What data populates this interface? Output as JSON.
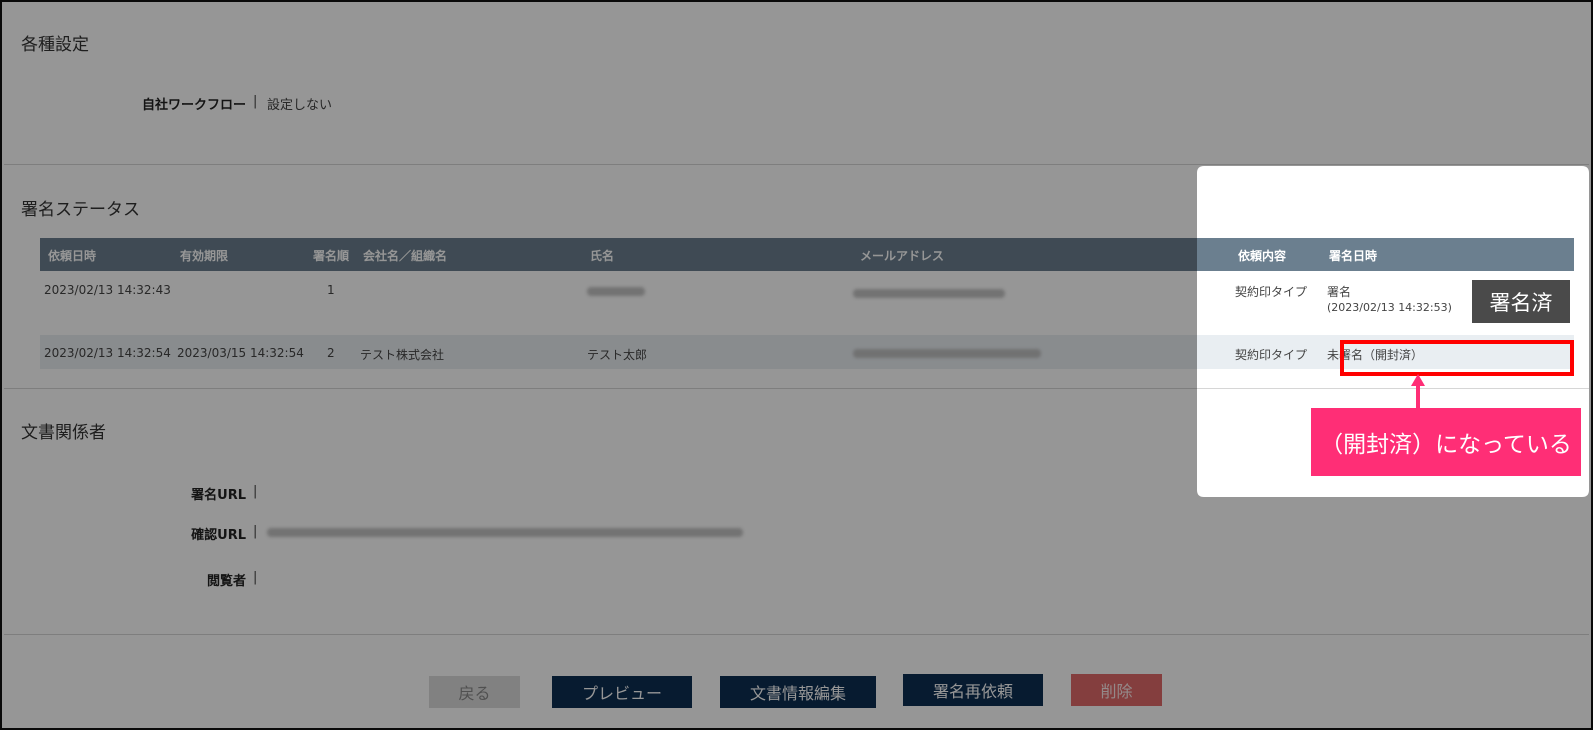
{
  "settings": {
    "title": "各種設定",
    "workflow_label": "自社ワークフロー",
    "separator": "|",
    "workflow_value": "設定しない"
  },
  "signature_status": {
    "title": "署名ステータス",
    "headers": [
      "依頼日時",
      "有効期限",
      "署名順",
      "会社名／組織名",
      "氏名",
      "メールアドレス",
      "依頼内容",
      "署名日時"
    ],
    "rows": [
      {
        "requested_at": "2023/02/13 14:32:43",
        "expires_at": "",
        "order": "1",
        "company": "",
        "name_redacted": true,
        "email_redacted": true,
        "request_type": "契約印タイプ",
        "sign_status": "署名",
        "sign_date": "(2023/02/13 14:32:53)"
      },
      {
        "requested_at": "2023/02/13 14:32:54",
        "expires_at": "2023/03/15 14:32:54",
        "order": "2",
        "company": "テスト株式会社",
        "name": "テスト太郎",
        "email_redacted": true,
        "request_type": "契約印タイプ",
        "sign_status": "未署名（開封済）"
      }
    ]
  },
  "related": {
    "title": "文書関係者",
    "sign_url_label": "署名URL",
    "confirm_url_label": "確認URL",
    "viewer_label": "閲覧者",
    "separator": "|"
  },
  "buttons": {
    "back": "戻る",
    "preview": "プレビュー",
    "edit_info": "文書情報編集",
    "resend": "署名再依頼",
    "delete": "削除"
  },
  "annotations": {
    "signed_badge": "署名済",
    "callout": "（開封済）になっている"
  },
  "colors": {
    "header_bg": "#6b7f8f",
    "button_navy": "#0d2e52",
    "button_delete": "#e06a6a",
    "highlight_red": "#ff0000",
    "callout_pink": "#ff2e76",
    "badge_dark": "#4a4a4a"
  }
}
